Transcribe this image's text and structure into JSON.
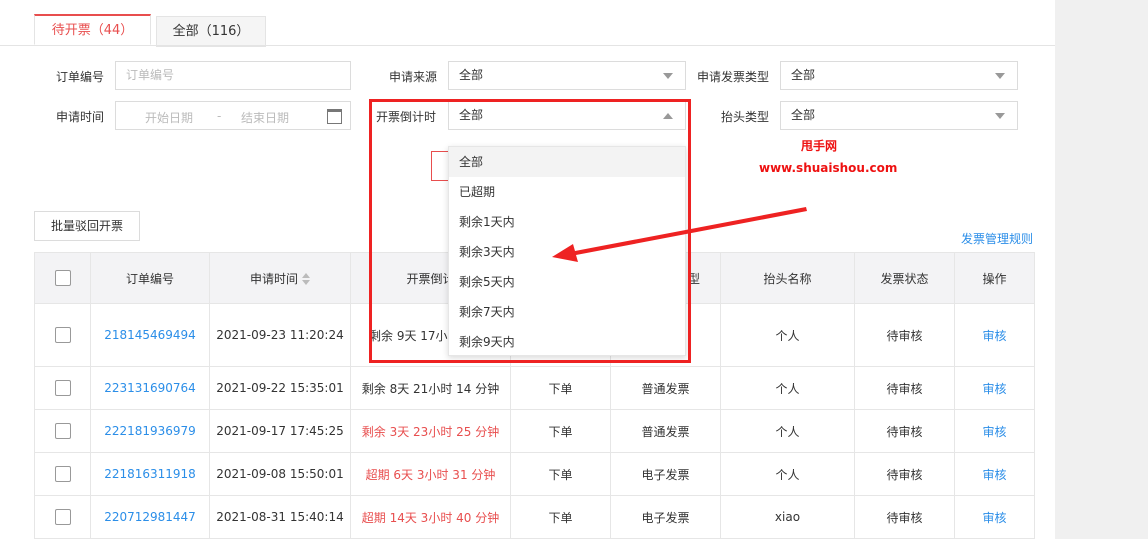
{
  "tabs": [
    {
      "label": "待开票（44）"
    },
    {
      "label": "全部（116）"
    }
  ],
  "filters": {
    "order_no_label": "订单编号",
    "order_no_placeholder": "订单编号",
    "source_label": "申请来源",
    "source_value": "全部",
    "invoice_type_label": "申请发票类型",
    "invoice_type_value": "全部",
    "apply_time_label": "申请时间",
    "start_date_placeholder": "开始日期",
    "date_sep": "-",
    "end_date_placeholder": "结束日期",
    "countdown_label": "开票倒计时",
    "countdown_value": "全部",
    "header_type_label": "抬头类型",
    "header_type_value": "全部"
  },
  "dropdown": {
    "options": [
      "全部",
      "已超期",
      "剩余1天内",
      "剩余3天内",
      "剩余5天内",
      "剩余7天内",
      "剩余9天内"
    ]
  },
  "watermark": {
    "line1": "甩手网",
    "line2": "www.shuaishou.com"
  },
  "toolbar": {
    "batch_reject": "批量驳回开票",
    "rules_link": "发票管理规则"
  },
  "table": {
    "headers": [
      "订单编号",
      "申请时间",
      "开票倒计",
      "型",
      "抬头名称",
      "发票状态",
      "操作"
    ],
    "rows": [
      {
        "order": "218145469494",
        "time": "2021-09-23 11:20:24",
        "countdown": "剩余 9天 17小时",
        "source": "",
        "type": "",
        "name": "个人",
        "status": "待审核",
        "action": "审核"
      },
      {
        "order": "223131690764",
        "time": "2021-09-22 15:35:01",
        "countdown": "剩余 8天 21小时 14 分钟",
        "source": "下单",
        "type": "普通发票",
        "name": "个人",
        "status": "待审核",
        "action": "审核"
      },
      {
        "order": "222181936979",
        "time": "2021-09-17 17:45:25",
        "countdown": "剩余 3天 23小时 25 分钟",
        "source": "下单",
        "type": "普通发票",
        "name": "个人",
        "status": "待审核",
        "action": "审核"
      },
      {
        "order": "221816311918",
        "time": "2021-09-08 15:50:01",
        "countdown": "超期 6天 3小时 31 分钟",
        "source": "下单",
        "type": "电子发票",
        "name": "个人",
        "status": "待审核",
        "action": "审核"
      },
      {
        "order": "220712981447",
        "time": "2021-08-31 15:40:14",
        "countdown": "超期 14天 3小时 40 分钟",
        "source": "下单",
        "type": "电子发票",
        "name": "xiao",
        "status": "待审核",
        "action": "审核"
      }
    ]
  },
  "colors": {
    "accent": "#e84e4e",
    "link": "#2b8ee8",
    "annotation": "#ee2222"
  }
}
